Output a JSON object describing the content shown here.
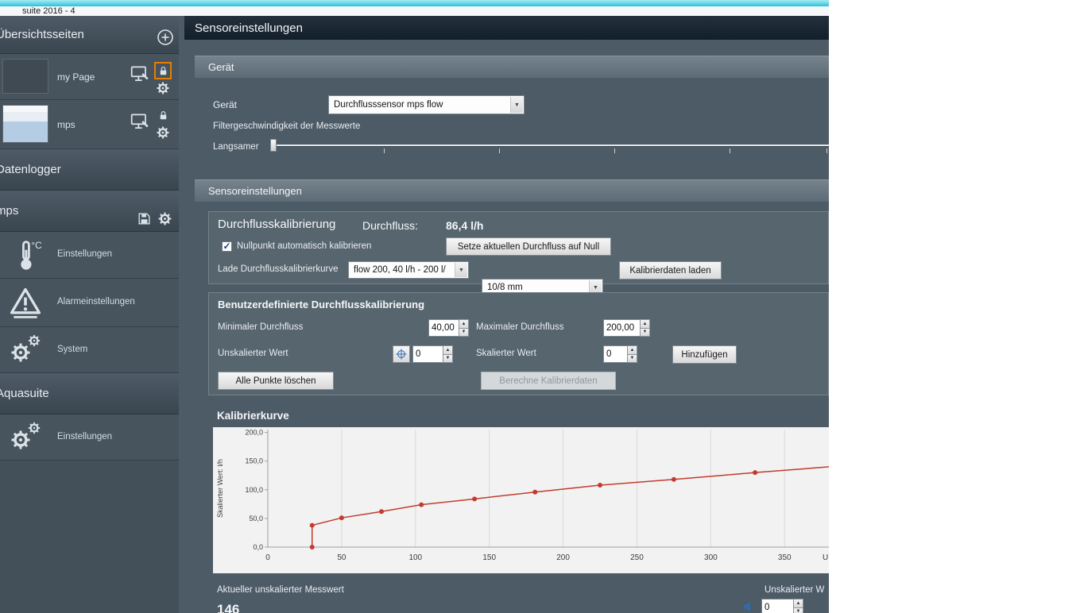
{
  "window": {
    "title": "suite 2016 - 4"
  },
  "sidebar": {
    "overview_header": "Übersichtsseiten",
    "pages": [
      {
        "label": "my Page"
      },
      {
        "label": "mps"
      }
    ],
    "datenlogger_header": "Datenlogger",
    "mps_header": "mps",
    "mps_items": [
      {
        "label": "Einstellungen"
      },
      {
        "label": "Alarmeinstellungen"
      },
      {
        "label": "System"
      }
    ],
    "aquasuite_header": "Aquasuite",
    "aquasuite_items": [
      {
        "label": "Einstellungen"
      }
    ]
  },
  "main": {
    "title": "Sensoreinstellungen",
    "geraet": {
      "header": "Gerät",
      "device_label": "Gerät",
      "device_value": "Durchflusssensor mps flow",
      "filter_label": "Filtergeschwindigkeit der Messwerte",
      "slider_label": "Langsamer"
    },
    "sensor": {
      "header": "Sensoreinstellungen",
      "calibration": {
        "title": "Durchflusskalibrierung",
        "flow_label": "Durchfluss:",
        "flow_value": "86,4 l/h",
        "checkbox_label": "Nullpunkt automatisch kalibrieren",
        "checkbox_checked": true,
        "zero_button": "Setze aktuellen Durchfluss auf Null",
        "load_label": "Lade Durchflusskalibrierkurve",
        "curve_value": "flow 200, 40 l/h - 200 l/",
        "size_value": "10/8 mm",
        "load_button": "Kalibrierdaten laden"
      },
      "custom": {
        "title": "Benutzerdefinierte Durchflusskalibrierung",
        "min_label": "Minimaler Durchfluss",
        "min_value": "40,00",
        "max_label": "Maximaler Durchfluss",
        "max_value": "200,00",
        "unscaled_label": "Unskalierter Wert",
        "unscaled_value": "0",
        "scaled_label": "Skalierter Wert",
        "scaled_value": "0",
        "add_button": "Hinzufügen",
        "clear_button": "Alle Punkte löschen",
        "calc_button": "Berechne Kalibrierdaten"
      }
    },
    "curve_title": "Kalibrierkurve",
    "footer": {
      "current_label": "Aktueller unskalierter Messwert",
      "current_value": "146",
      "right_label": "Unskalierter W",
      "spin_value": "0"
    }
  },
  "chart_data": {
    "type": "line",
    "title": "Kalibrierkurve",
    "xlabel_visible": "U",
    "ylabel": "Skalierter Wert: l/h",
    "xlim": [
      0,
      380
    ],
    "ylim": [
      0,
      205
    ],
    "x_tick_values": [
      0,
      50,
      100,
      150,
      200,
      250,
      300,
      350
    ],
    "x_tick_labels": [
      "0",
      "50",
      "100",
      "150",
      "200",
      "250",
      "300",
      "350"
    ],
    "y_tick_values": [
      0,
      50,
      100,
      150,
      200
    ],
    "y_tick_labels": [
      "0,0",
      "50,0",
      "100,0",
      "150,0",
      "200,0"
    ],
    "grid": true,
    "grid_color": "#dadada",
    "line_color": "#c23b2e",
    "points": [
      [
        30,
        0
      ],
      [
        30,
        38
      ],
      [
        50,
        51
      ],
      [
        77,
        62
      ],
      [
        104,
        74
      ],
      [
        140,
        84
      ],
      [
        181,
        96
      ],
      [
        225,
        108
      ],
      [
        275,
        118
      ],
      [
        330,
        130
      ],
      [
        385,
        141
      ]
    ]
  },
  "colors": {
    "accent_orange": "#e67e00",
    "titlebar_cyan": "#2cc3da",
    "chart_line": "#c23b2e",
    "icon_blue": "#2d6cb5"
  }
}
